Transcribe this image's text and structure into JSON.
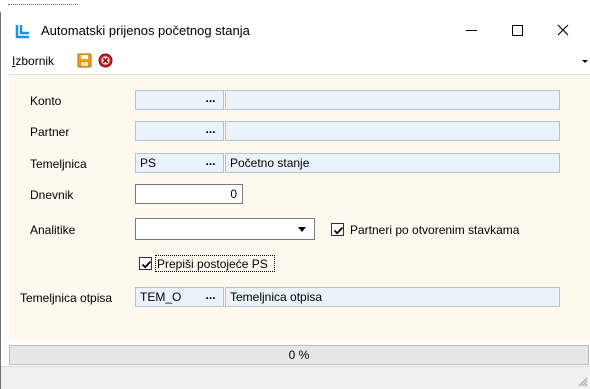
{
  "window": {
    "title": "Automatski prijenos početnog stanja",
    "controls": {
      "minimize": "—",
      "maximize": "☐",
      "close": "✕"
    }
  },
  "menubar": {
    "menu_label_first": "I",
    "menu_label_rest": "zbornik",
    "icons": [
      "save-icon",
      "cancel-icon"
    ]
  },
  "form": {
    "konto": {
      "label": "Konto",
      "code": "",
      "lookup": "...",
      "description": ""
    },
    "partner": {
      "label": "Partner",
      "code": "",
      "lookup": "...",
      "description": ""
    },
    "temeljnica": {
      "label": "Temeljnica",
      "code": "PS",
      "lookup": "...",
      "description": "Početno stanje"
    },
    "dnevnik": {
      "label": "Dnevnik",
      "value": "0"
    },
    "analitike": {
      "label": "Analitike",
      "selected": ""
    },
    "partneri_checkbox": {
      "label": "Partneri po otvorenim stavkama",
      "checked": true
    },
    "prepisi_checkbox": {
      "label": "Prepiši postojeće PS",
      "checked": true
    },
    "temeljnica_otpisa": {
      "label": "Temeljnica otpisa",
      "code": "TEM_O",
      "lookup": "...",
      "description": "Temeljnica otpisa"
    }
  },
  "progress": {
    "text": "0 %",
    "value": 0
  },
  "colors": {
    "form_background": "#fdf9ee",
    "field_background": "#eaf2fa",
    "icon_blue": "#1e90e0",
    "save_orange": "#f4a020",
    "cancel_red": "#c8202a"
  }
}
